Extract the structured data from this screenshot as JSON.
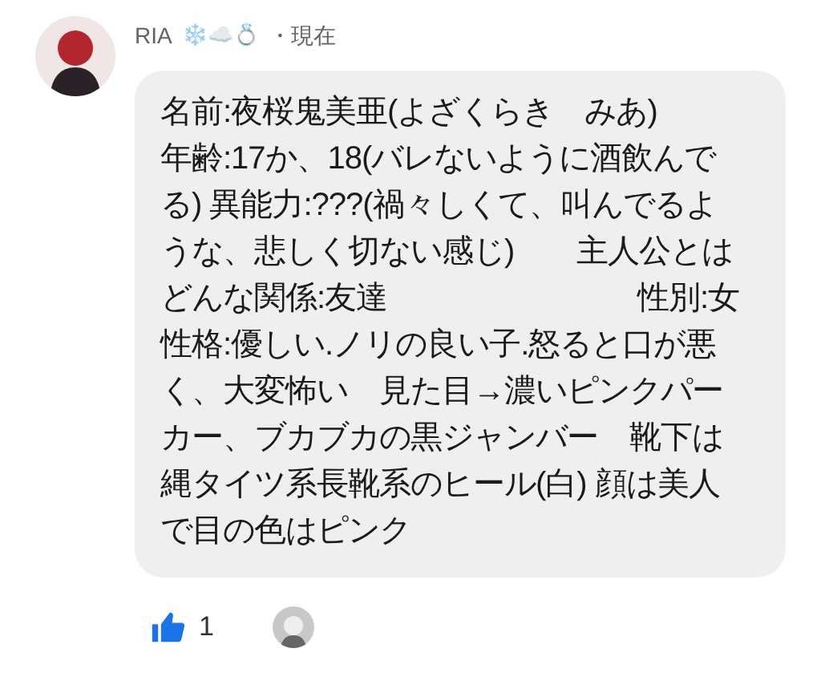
{
  "comment": {
    "author": "RIA",
    "badges": "❄️☁️💍",
    "time": "・現在",
    "message_lines": [
      "名前:夜桜鬼美亜(よざくらき　みあ)",
      "年齢:17か、18(バレないように酒飲んで",
      "る) 異能力:???(禍々しくて、叫んでるよ",
      "うな、悲しく切ない感じ)　　主人公とは",
      "どんな関係:友達　　　　　　　　性別:女",
      "性格:優しい.ノリの良い子.怒ると口が悪",
      "く、大変怖い　見た目→濃いピンクパー",
      "カー、ブカブカの黒ジャンバー　靴下は",
      "縄タイツ系長靴系のヒール(白) 顔は美人",
      "で目の色はピンク"
    ],
    "likes": "1"
  }
}
